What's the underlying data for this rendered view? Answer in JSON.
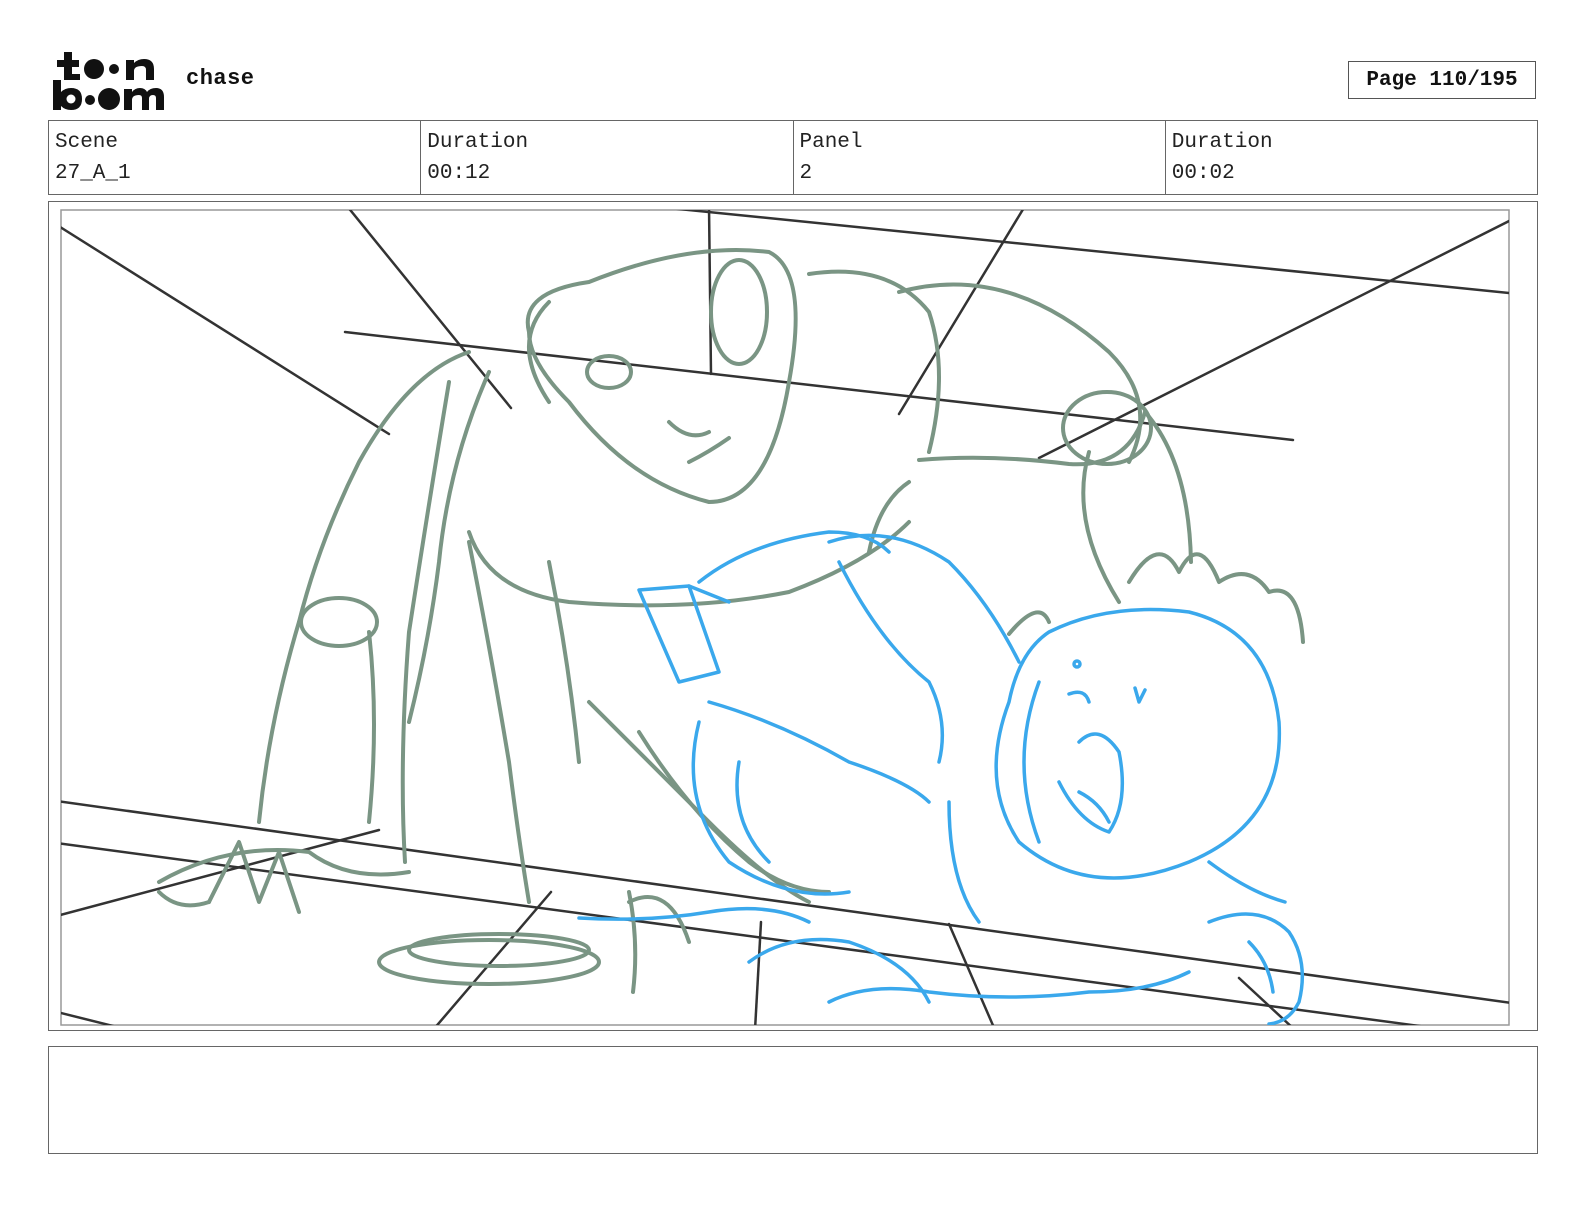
{
  "header": {
    "logo_text": "toon boom",
    "project_title": "chase",
    "page_label": "Page 110/195"
  },
  "info": [
    {
      "label": "Scene",
      "value": "27_A_1"
    },
    {
      "label": "Duration",
      "value": "00:12"
    },
    {
      "label": "Panel",
      "value": "2"
    },
    {
      "label": "Duration",
      "value": "00:02"
    }
  ],
  "panel": {
    "sketch_colors": {
      "perspective_lines": "#333333",
      "character_green": "#7a9584",
      "character_blue": "#3aa8ec"
    }
  },
  "notes": {
    "text": ""
  }
}
